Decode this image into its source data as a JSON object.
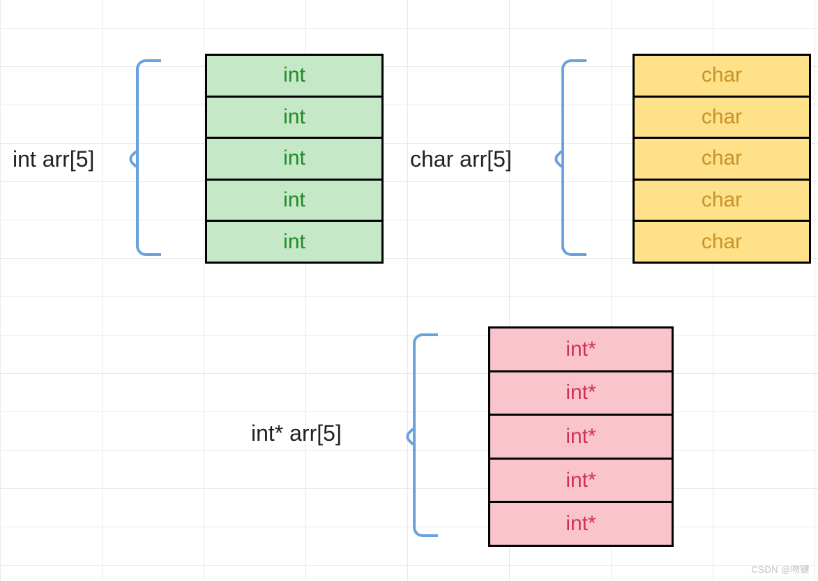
{
  "arrays": {
    "int": {
      "label": "int arr[5]",
      "cells": [
        "int",
        "int",
        "int",
        "int",
        "int"
      ]
    },
    "char": {
      "label": "char arr[5]",
      "cells": [
        "char",
        "char",
        "char",
        "char",
        "char"
      ]
    },
    "intptr": {
      "label": "int* arr[5]",
      "cells": [
        "int*",
        "int*",
        "int*",
        "int*",
        "int*"
      ]
    }
  },
  "watermark": "CSDN @吻键"
}
